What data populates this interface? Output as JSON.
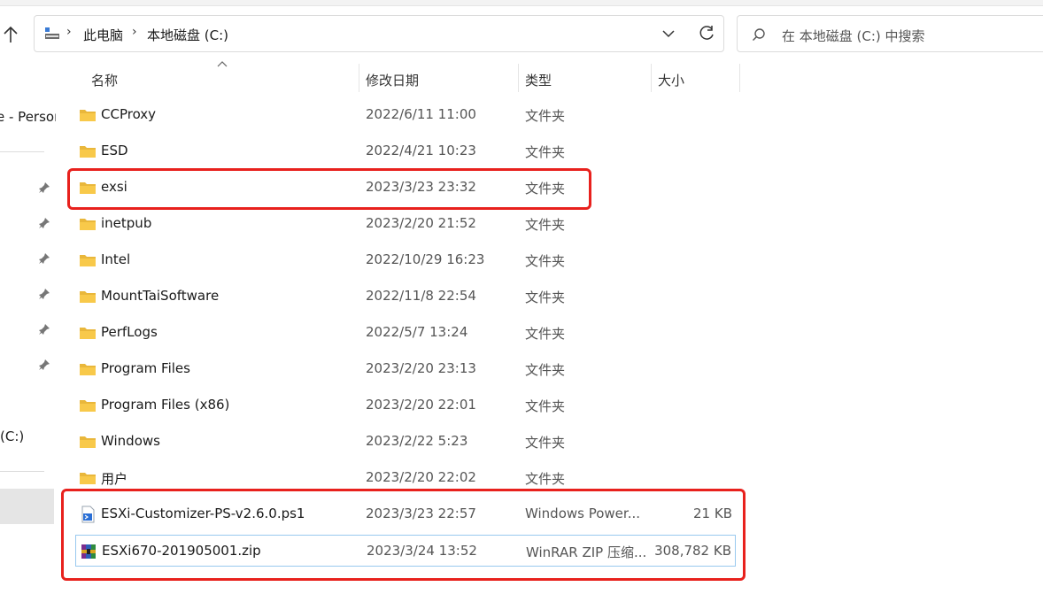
{
  "breadcrumbs": [
    "此电脑",
    "本地磁盘 (C:)"
  ],
  "search": {
    "placeholder": "在 本地磁盘 (C:) 中搜索"
  },
  "nav": {
    "quick_access_label": "e - Person",
    "drive_label": "(C:)"
  },
  "columns": {
    "name": "名称",
    "date": "修改日期",
    "type": "类型",
    "size": "大小"
  },
  "files": [
    {
      "name": "CCProxy",
      "date": "2022/6/11 11:00",
      "type": "文件夹",
      "size": "",
      "icon": "folder-icon"
    },
    {
      "name": "ESD",
      "date": "2022/4/21 10:23",
      "type": "文件夹",
      "size": "",
      "icon": "folder-icon"
    },
    {
      "name": "exsi",
      "date": "2023/3/23 23:32",
      "type": "文件夹",
      "size": "",
      "icon": "folder-icon"
    },
    {
      "name": "inetpub",
      "date": "2023/2/20 21:52",
      "type": "文件夹",
      "size": "",
      "icon": "folder-icon"
    },
    {
      "name": "Intel",
      "date": "2022/10/29 16:23",
      "type": "文件夹",
      "size": "",
      "icon": "folder-icon"
    },
    {
      "name": "MountTaiSoftware",
      "date": "2022/11/8 22:54",
      "type": "文件夹",
      "size": "",
      "icon": "folder-icon"
    },
    {
      "name": "PerfLogs",
      "date": "2022/5/7 13:24",
      "type": "文件夹",
      "size": "",
      "icon": "folder-icon"
    },
    {
      "name": "Program Files",
      "date": "2023/2/20 23:13",
      "type": "文件夹",
      "size": "",
      "icon": "folder-icon"
    },
    {
      "name": "Program Files (x86)",
      "date": "2023/2/20 22:01",
      "type": "文件夹",
      "size": "",
      "icon": "folder-icon"
    },
    {
      "name": "Windows",
      "date": "2023/2/22 5:23",
      "type": "文件夹",
      "size": "",
      "icon": "folder-icon"
    },
    {
      "name": "用户",
      "date": "2023/2/20 22:02",
      "type": "文件夹",
      "size": "",
      "icon": "folder-icon"
    },
    {
      "name": "ESXi-Customizer-PS-v2.6.0.ps1",
      "date": "2023/3/23 22:57",
      "type": "Windows Power...",
      "size": "21 KB",
      "icon": "powershell-script-icon"
    },
    {
      "name": "ESXi670-201905001.zip",
      "date": "2023/3/24 13:52",
      "type": "WinRAR ZIP 压缩...",
      "size": "308,782 KB",
      "icon": "winrar-archive-icon"
    }
  ],
  "colors": {
    "highlight": "#e8211d",
    "folder": "#f8c94a",
    "selection_border": "#99c9ef"
  }
}
